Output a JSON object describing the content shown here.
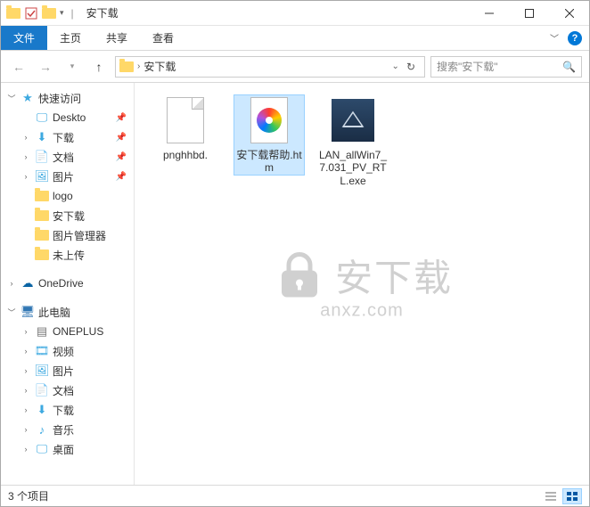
{
  "title": "安下载",
  "ribbon": {
    "file": "文件",
    "home": "主页",
    "share": "共享",
    "view": "查看"
  },
  "breadcrumb": {
    "location": "安下载"
  },
  "search": {
    "placeholder": "搜索\"安下载\""
  },
  "nav": {
    "quick_access": "快速访问",
    "items": [
      {
        "label": "Deskto",
        "icon": "desktop",
        "pinned": true
      },
      {
        "label": "下载",
        "icon": "downloads",
        "pinned": true
      },
      {
        "label": "文档",
        "icon": "documents",
        "pinned": true
      },
      {
        "label": "图片",
        "icon": "pictures",
        "pinned": true
      },
      {
        "label": "logo",
        "icon": "folder",
        "pinned": false
      },
      {
        "label": "安下载",
        "icon": "folder",
        "pinned": false
      },
      {
        "label": "图片管理器",
        "icon": "folder",
        "pinned": false
      },
      {
        "label": "未上传",
        "icon": "folder",
        "pinned": false
      }
    ],
    "onedrive": "OneDrive",
    "this_pc": "此电脑",
    "pc_items": [
      {
        "label": "ONEPLUS",
        "icon": "device"
      },
      {
        "label": "视频",
        "icon": "videos"
      },
      {
        "label": "图片",
        "icon": "pictures"
      },
      {
        "label": "文档",
        "icon": "documents"
      },
      {
        "label": "下载",
        "icon": "downloads"
      },
      {
        "label": "音乐",
        "icon": "music"
      },
      {
        "label": "桌面",
        "icon": "desktop"
      }
    ]
  },
  "files": [
    {
      "name": "pnghhbd.",
      "type": "blank"
    },
    {
      "name": "安下载帮助.htm",
      "type": "htm",
      "selected": true
    },
    {
      "name": "LAN_allWin7_7.031_PV_RTL.exe",
      "type": "exe"
    }
  ],
  "watermark": {
    "cn": "安下载",
    "en": "anxz.com"
  },
  "status": {
    "count": "3 个项目"
  }
}
